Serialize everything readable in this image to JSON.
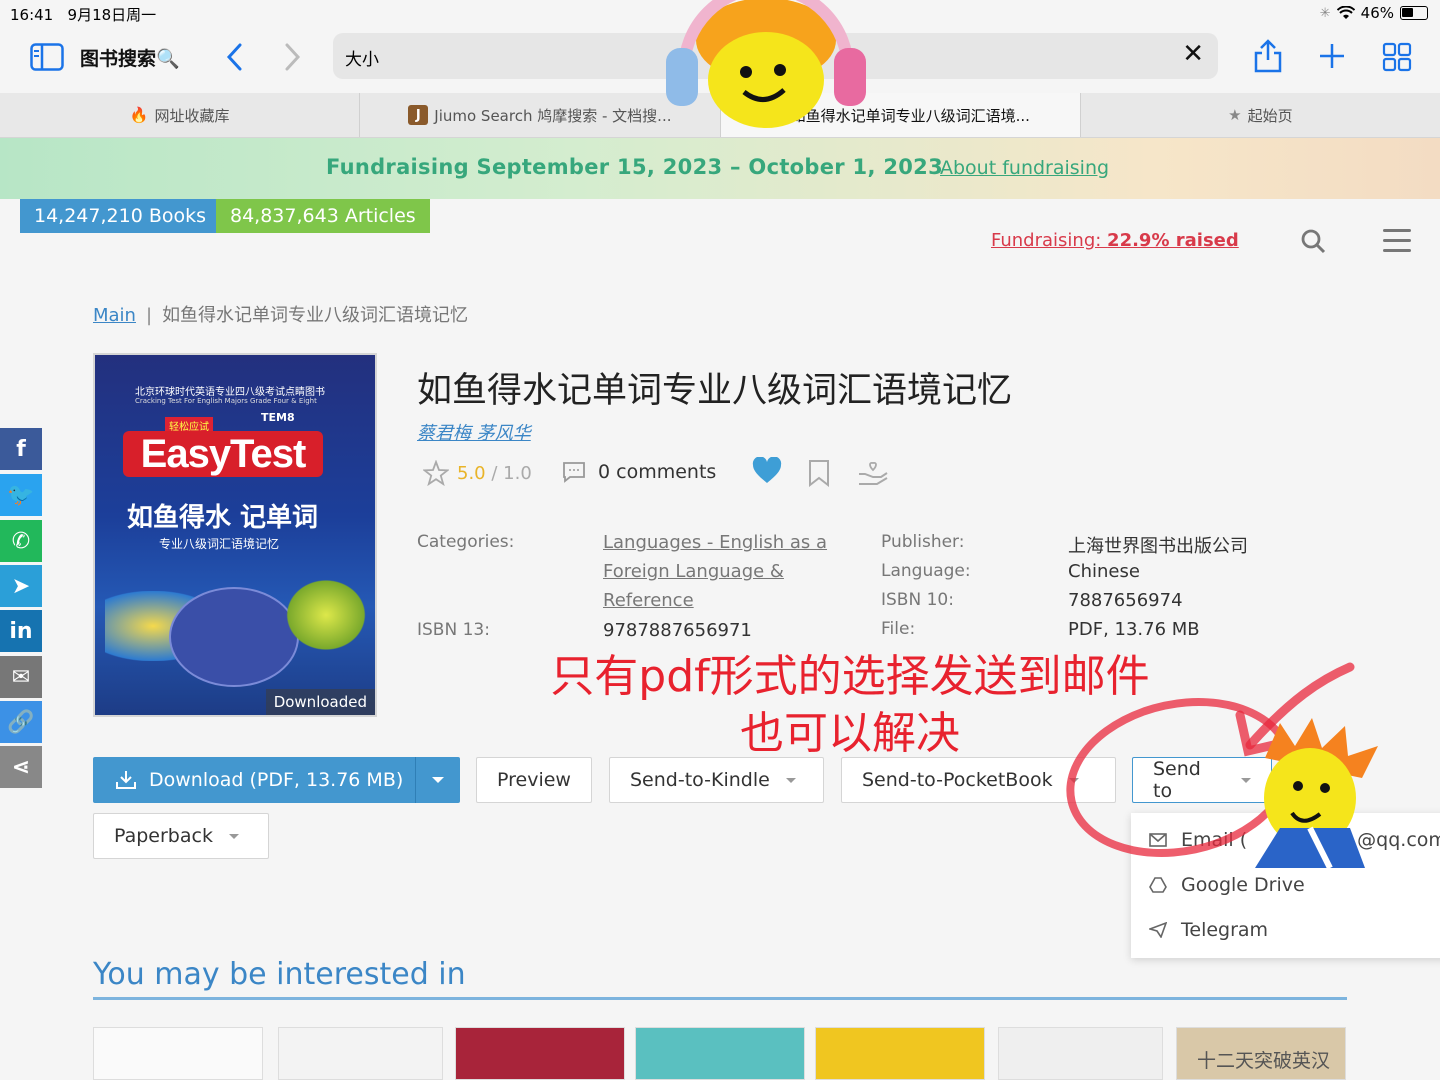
{
  "status_bar": {
    "time": "16:41",
    "date": "9月18日周一",
    "battery": "46%",
    "battery_level": 0.46
  },
  "browser": {
    "title": "图书搜索🔍",
    "url": "大小",
    "tabs": [
      {
        "label": "网址收藏库",
        "active": false
      },
      {
        "label": "Jiumo Search 鸠摩搜索 - 文档搜...",
        "active": false
      },
      {
        "label": "如鱼得水记单词专业八级词汇语境...",
        "active": true
      },
      {
        "label": "起始页",
        "active": false
      }
    ]
  },
  "banner": {
    "text": "Fundraising September 15, 2023 – October 1, 2023",
    "link": "About fundraising"
  },
  "counts": {
    "books": "14,247,210 Books",
    "articles": "84,837,643 Articles"
  },
  "fundraising_link": {
    "prefix": "Fundraising: ",
    "value": "22.9% raised"
  },
  "breadcrumb": {
    "home": "Main",
    "sep": "|",
    "current": "如鱼得水记单词专业八级词汇语境记忆"
  },
  "book": {
    "title": "如鱼得水记单词专业八级词汇语境记忆",
    "authors": "蔡君梅 茅风华",
    "rating": "5.0",
    "rating_max": "/ 1.0",
    "comments": "0 comments",
    "cover": {
      "publisher_line": "北京环球时代英语专业四八级考试点睛图书",
      "subtitle_en": "Cracking Test For English Majors Grade Four & Eight",
      "tag": "轻松应试",
      "tem": "TEM8",
      "brand": "EasyTest",
      "main_title": "如鱼得水 记单词",
      "sub_title": "专业八级词汇语境记忆",
      "status": "Downloaded"
    },
    "meta": {
      "categories_label": "Categories:",
      "categories_value": "Languages - English as a Foreign Language & Reference",
      "isbn13_label": "ISBN 13:",
      "isbn13_value": "9787887656971",
      "publisher_label": "Publisher:",
      "publisher_value": "上海世界图书出版公司",
      "language_label": "Language:",
      "language_value": "Chinese",
      "isbn10_label": "ISBN 10:",
      "isbn10_value": "7887656974",
      "file_label": "File:",
      "file_value": "PDF, 13.76 MB"
    }
  },
  "annotation": {
    "line1": "只有pdf形式的选择发送到邮件",
    "line2": "也可以解决"
  },
  "buttons": {
    "download": "Download (PDF, 13.76 MB)",
    "preview": "Preview",
    "kindle": "Send-to-Kindle",
    "pocketbook": "Send-to-PocketBook",
    "send_to": "Send to",
    "paperback": "Paperback"
  },
  "send_to_menu": [
    {
      "label": "Email (",
      "suffix": "@qq.com"
    },
    {
      "label": "Google Drive"
    },
    {
      "label": "Telegram"
    }
  ],
  "section": {
    "interested": "You may be interested in"
  },
  "thumbnails": {
    "last_title": "十二天突破英汉"
  },
  "colors": {
    "accent_blue": "#4397cf",
    "link_blue": "#3b86c6",
    "green": "#37a77c",
    "red": "#e8222e"
  }
}
